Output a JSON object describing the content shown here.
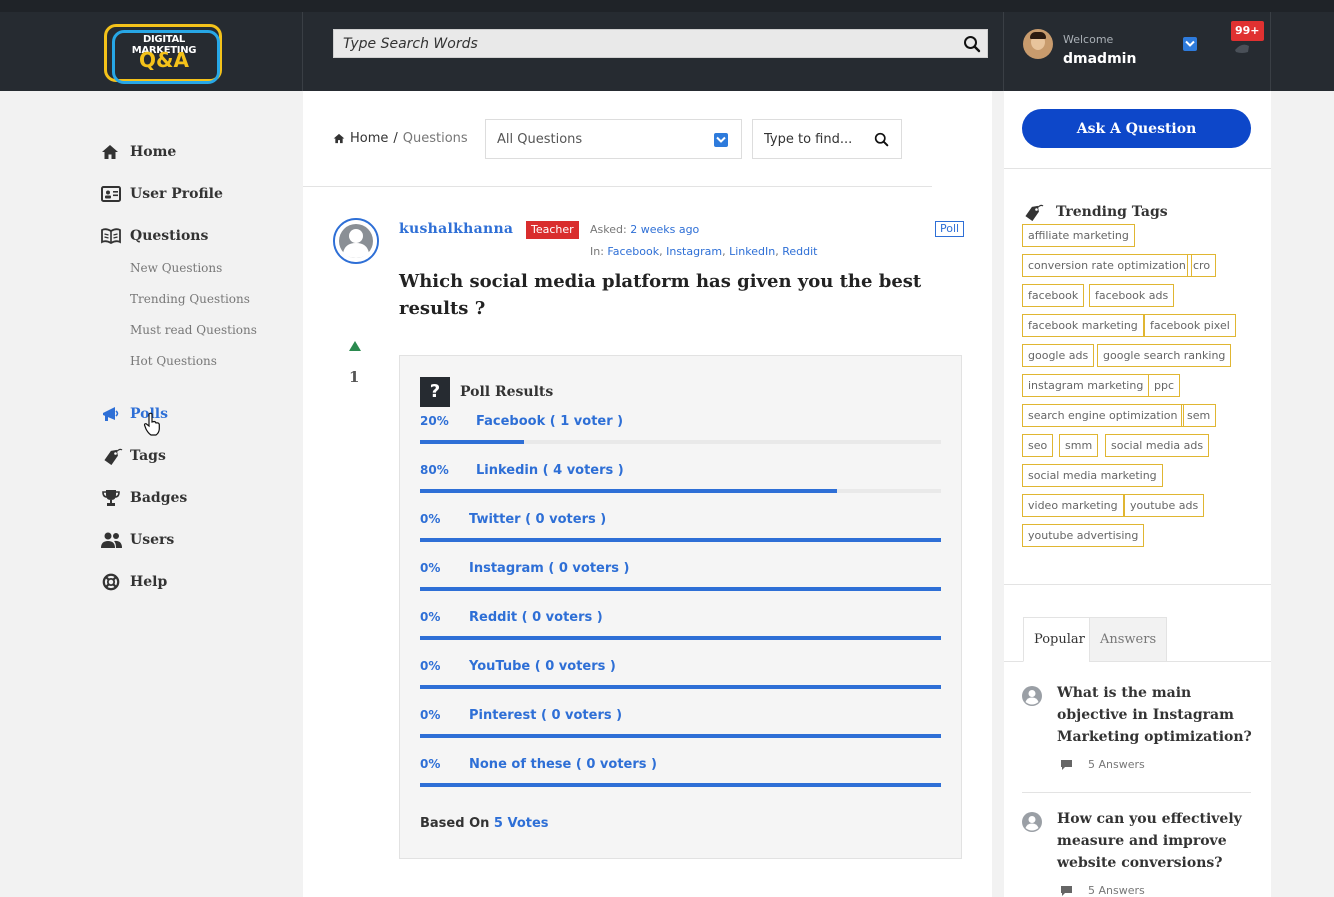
{
  "header": {
    "logo_line1": "DIGITAL MARKETING",
    "logo_line2": "Q&A",
    "search_placeholder": "Type Search Words",
    "welcome": "Welcome",
    "username": "dmadmin",
    "notifications": "99+"
  },
  "sidebar": {
    "items": [
      {
        "label": "Home",
        "icon": "home-icon"
      },
      {
        "label": "User Profile",
        "icon": "id-card-icon"
      },
      {
        "label": "Questions",
        "icon": "book-icon"
      }
    ],
    "sub_items": [
      "New Questions",
      "Trending Questions",
      "Must read Questions",
      "Hot Questions"
    ],
    "items2": [
      {
        "label": "Polls",
        "icon": "megaphone-icon",
        "active": true
      },
      {
        "label": "Tags",
        "icon": "tag-icon"
      },
      {
        "label": "Badges",
        "icon": "trophy-icon"
      },
      {
        "label": "Users",
        "icon": "users-icon"
      },
      {
        "label": "Help",
        "icon": "lifebuoy-icon"
      }
    ]
  },
  "breadcrumb": {
    "home": "Home",
    "sep": "/",
    "current": "Questions"
  },
  "filter": {
    "selected": "All Questions",
    "find_placeholder": "Type to find..."
  },
  "question": {
    "author": "kushalkhanna",
    "role_badge": "Teacher",
    "asked_label": "Asked:",
    "asked_time": "2 weeks ago",
    "in_label": "In:",
    "categories": [
      "Facebook",
      "Instagram",
      "LinkedIn",
      "Reddit"
    ],
    "type_badge": "Poll",
    "title": "Which social media platform has given you the best results ?",
    "votes": "1"
  },
  "poll": {
    "heading": "Poll Results",
    "options": [
      {
        "pct": "20%",
        "label": "Facebook ( 1 voter )",
        "value": 0.2
      },
      {
        "pct": "80%",
        "label": "Linkedin ( 4 voters )",
        "value": 0.8
      },
      {
        "pct": "0%",
        "label": "Twitter ( 0 voters )",
        "value": 1.0
      },
      {
        "pct": "0%",
        "label": "Instagram ( 0 voters )",
        "value": 1.0
      },
      {
        "pct": "0%",
        "label": "Reddit ( 0 voters )",
        "value": 1.0
      },
      {
        "pct": "0%",
        "label": "YouTube ( 0 voters )",
        "value": 1.0
      },
      {
        "pct": "0%",
        "label": "Pinterest ( 0 voters )",
        "value": 1.0
      },
      {
        "pct": "0%",
        "label": "None of these ( 0 voters )",
        "value": 1.0
      }
    ],
    "based_on_label": "Based On",
    "based_on_votes": "5 Votes"
  },
  "right": {
    "ask_button": "Ask A Question",
    "trending_title": "Trending Tags",
    "tags": [
      "affiliate marketing",
      "conversion rate optimization",
      "cro",
      "facebook",
      "facebook ads",
      "facebook marketing",
      "facebook pixel",
      "google ads",
      "google search ranking",
      "instagram marketing",
      "ppc",
      "search engine optimization",
      "sem",
      "seo",
      "smm",
      "social media ads",
      "social media marketing",
      "video marketing",
      "youtube ads",
      "youtube advertising"
    ],
    "tabs": [
      "Popular",
      "Answers"
    ],
    "popular": [
      {
        "title": "What is the main objective in Instagram Marketing optimization?",
        "answers": "5 Answers"
      },
      {
        "title": "How can you effectively measure and improve website conversions?",
        "answers": "5 Answers"
      }
    ]
  },
  "colors": {
    "accent": "#2e6fd6",
    "header_bg": "#262b31",
    "ask_button": "#0d47c9",
    "teacher_badge": "#d92d2d",
    "tag_border": "#e0b632",
    "vote_up": "#2b8a4f"
  }
}
